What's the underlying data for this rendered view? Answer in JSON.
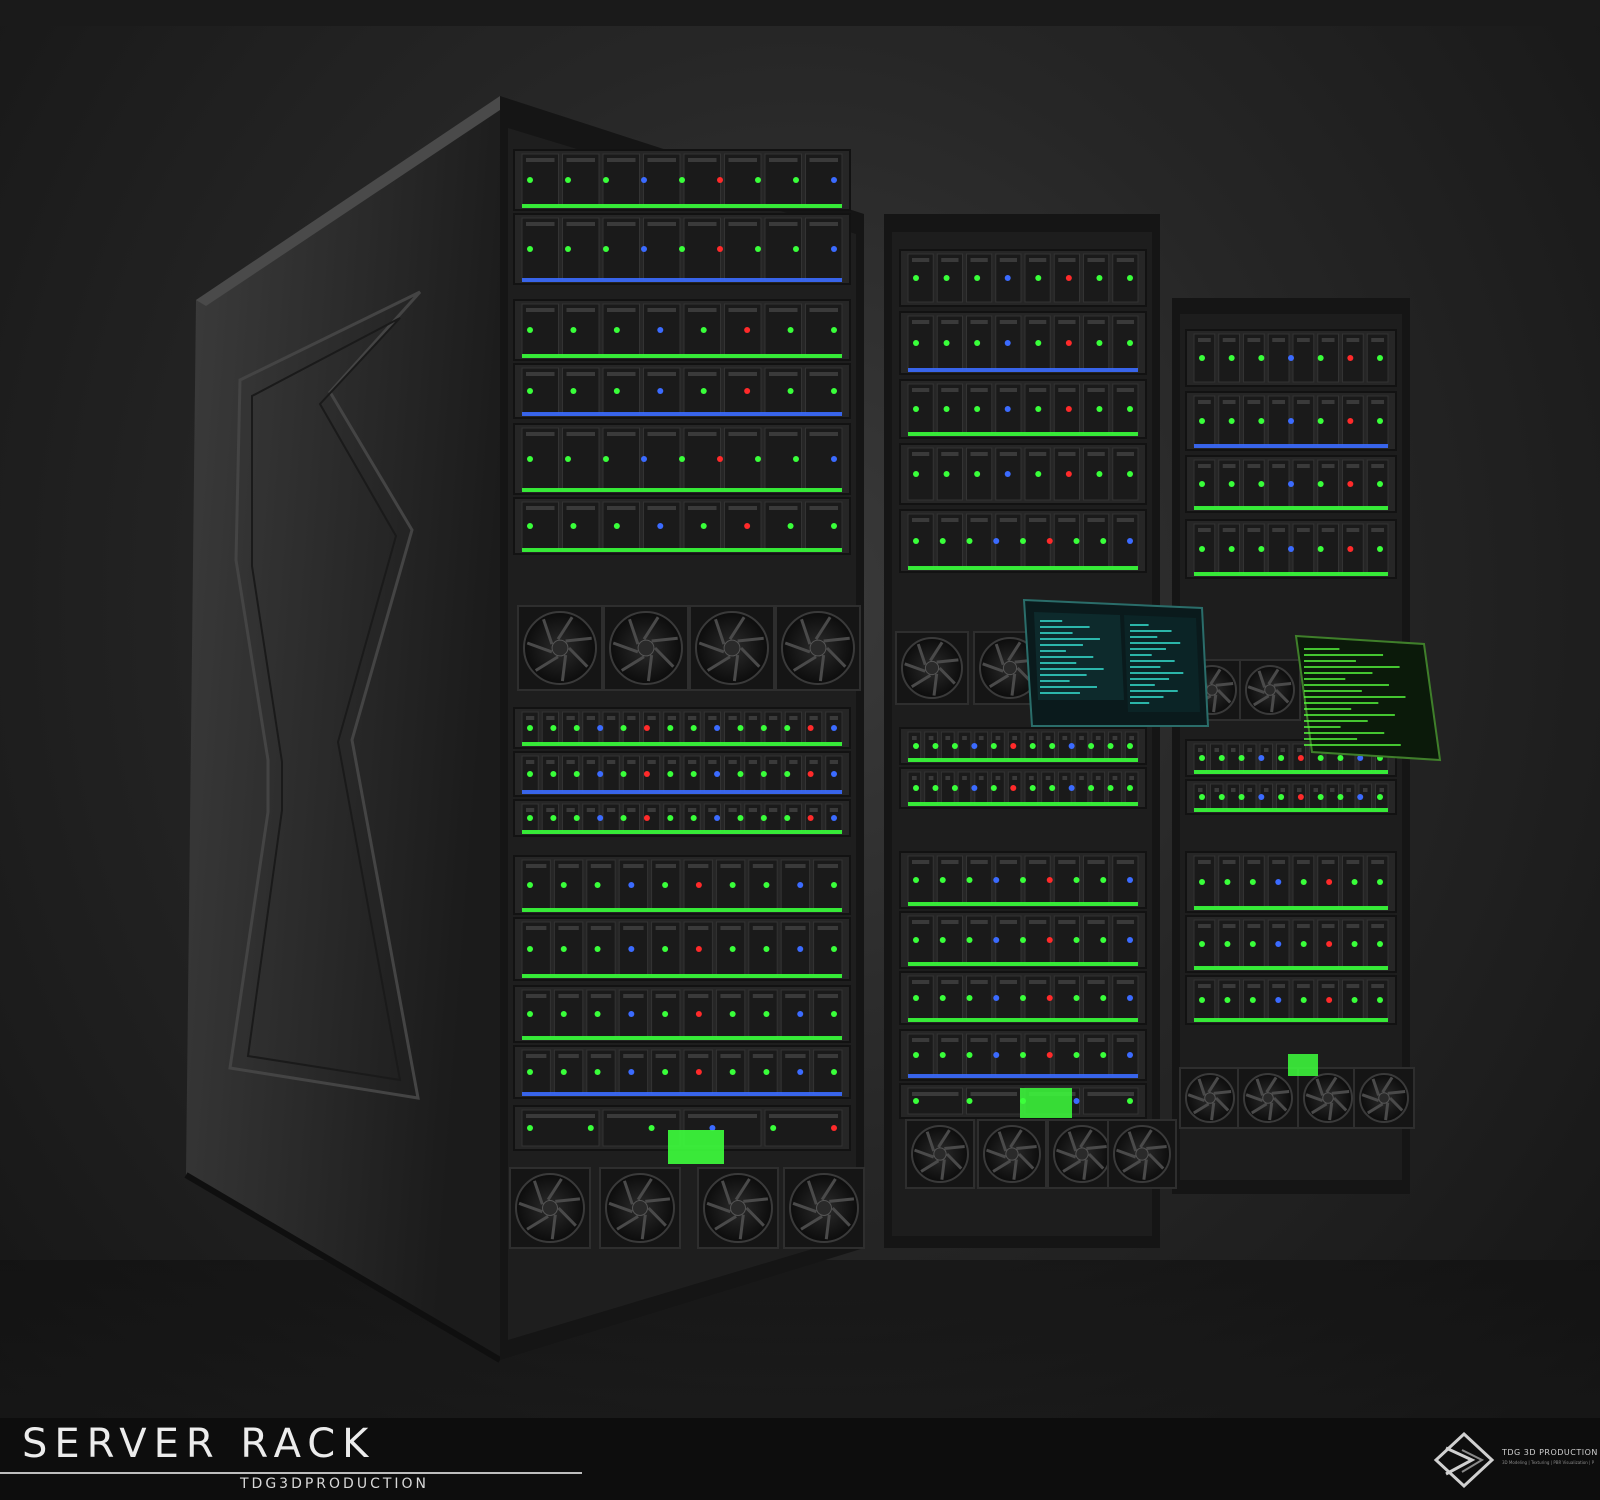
{
  "caption": {
    "title": "SERVER RACK",
    "subtitle": "TDG3DPRODUCTION"
  },
  "watermark": {
    "logo_icon": "tdg-diamond-logo-icon",
    "name": "TDG 3D PRODUCTION",
    "tagline": "3D Modeling | Texturing | PBR Visualization | Photographed Renders"
  },
  "colors": {
    "led_green": "#39ff3a",
    "led_blue": "#3b6bff",
    "led_red": "#ff2a2a",
    "screen_cyan": "#37e6d6",
    "screen_green": "#58ff3e",
    "cabinet": "#2b2b2b"
  }
}
